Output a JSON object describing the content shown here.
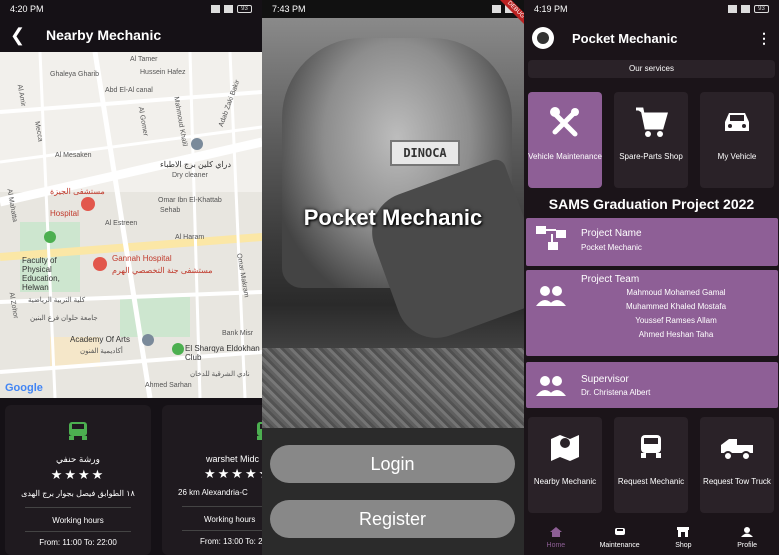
{
  "panel1": {
    "status": {
      "time": "4:20 PM",
      "battery": "93"
    },
    "title": "Nearby Mechanic",
    "map": {
      "labels": [
        "Al Tamer",
        "Hussein Hafez",
        "Ghaleya Gharib",
        "Abd El-Al canal",
        "Adab Zaki Bakir",
        "Mecca",
        "Al Gomer",
        "Mahmoud Khalil",
        "Al Mesaken",
        "دراي كلين برج الاطباء",
        "Dry cleaner",
        "مستشفى الجيزة",
        "Hospital",
        "Omar Ibn El-Khattab",
        "Sehab",
        "Al Estreen",
        "Al Haram",
        "Faculty of Physical Education, Helwan",
        "كلية التربية الرياضية",
        "جامعة حلوان فرع البنين",
        "Gannah Hospital",
        "مستشفى جنة التخصصي الهرم",
        "Omar Makram",
        "Bank Misr",
        "Academy Of Arts",
        "أكاديمية الفنون",
        "El Sharqya Eldokhan Club",
        "نادي الشرقية للدخان",
        "Ahmed Sarhan",
        "Al Amir",
        "Al Mahatta",
        "Al Zohor"
      ],
      "attribution": "Google"
    },
    "cards": [
      {
        "name": "ورشة حنفي",
        "stars": "★★★★",
        "address": "١٨ الطوابق فيصل بجوار برج الهدى",
        "hours_label": "Working hours",
        "hours": "From: 11:00 To: 22:00"
      },
      {
        "name": "warshet Midc",
        "stars": "★★★★★",
        "address": "26 km Alexandria-C",
        "hours_label": "Working hours",
        "hours": "From: 13:00 To: 21"
      }
    ]
  },
  "panel2": {
    "status": {
      "time": "7:43 PM"
    },
    "debug_banner": "DEBUG",
    "plate": "DINOCA",
    "app_title": "Pocket Mechanic",
    "login_label": "Login",
    "register_label": "Register"
  },
  "panel3": {
    "status": {
      "time": "4:19 PM",
      "battery": "93"
    },
    "title": "Pocket Mechanic",
    "services_header": "Our services",
    "services": [
      {
        "label": "Vehicle Maintenance",
        "icon": "tools-icon"
      },
      {
        "label": "Spare-Parts Shop",
        "icon": "cart-icon"
      },
      {
        "label": "My Vehicle",
        "icon": "car-icon"
      }
    ],
    "project_title": "SAMS Graduation Project 2022",
    "project": {
      "heading": "Project Name",
      "value": "Pocket Mechanic"
    },
    "team": {
      "heading": "Project Team",
      "members": [
        "Mahmoud Mohamed Gamal",
        "Muhammed Khaled Mostafa",
        "Youssef Ramses Allam",
        "Ahmed Heshan Taha"
      ]
    },
    "supervisor": {
      "heading": "Supervisor",
      "value": "Dr. Christena Albert"
    },
    "actions": [
      {
        "label": "Nearby Mechanic",
        "icon": "map-icon"
      },
      {
        "label": "Request Mechanic",
        "icon": "mechanic-icon"
      },
      {
        "label": "Request Tow Truck",
        "icon": "tow-truck-icon"
      }
    ],
    "nav": [
      "Home",
      "Maintenance",
      "Shop",
      "Profile"
    ],
    "colors": {
      "accent": "#8e5f96",
      "tile": "#2a2228",
      "tile_active": "#8e5f96"
    }
  }
}
